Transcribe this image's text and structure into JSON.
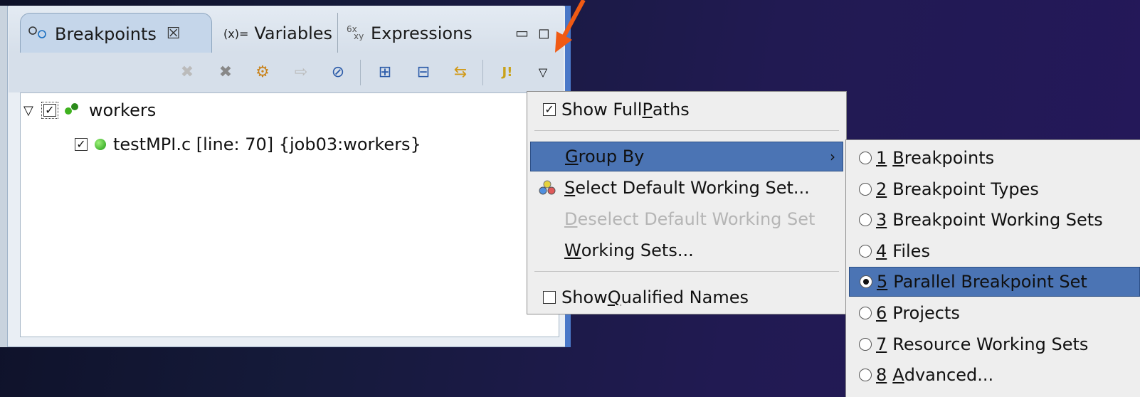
{
  "view": {
    "tabs": [
      {
        "label": "Breakpoints",
        "icon": "breakpoints-icon",
        "close": "☒"
      },
      {
        "label": "Variables",
        "icon": "variables-icon",
        "prefix": "(x)="
      },
      {
        "label": "Expressions",
        "icon": "expressions-icon"
      }
    ],
    "tree": [
      {
        "label": "workers",
        "checked": true,
        "expanded": true
      },
      {
        "label": "testMPI.c [line: 70] {job03:workers}",
        "checked": true
      }
    ]
  },
  "view_menu": {
    "show_full_paths": {
      "pre": "Show Full ",
      "ul": "P",
      "post": "aths"
    },
    "group_by": {
      "ul": "G",
      "post": "roup By"
    },
    "select_default": {
      "ul": "S",
      "post": "elect Default Working Set..."
    },
    "deselect_default": {
      "ul": "D",
      "post": "eselect Default Working Set"
    },
    "working_sets": {
      "ul": "W",
      "post": "orking Sets..."
    },
    "show_qualified": {
      "pre": "Show ",
      "ul": "Q",
      "post": "ualified Names"
    }
  },
  "group_by_menu": [
    {
      "num": "1",
      "ul": "B",
      "text": "reakpoints",
      "selected": false
    },
    {
      "num": "2",
      "ul": "",
      "text": "Breakpoint Types",
      "selected": false
    },
    {
      "num": "3",
      "ul": "",
      "text": "Breakpoint Working Sets",
      "selected": false
    },
    {
      "num": "4",
      "ul": "",
      "text": "Files",
      "selected": false
    },
    {
      "num": "5",
      "ul": "",
      "text": "Parallel Breakpoint Set",
      "selected": true
    },
    {
      "num": "6",
      "ul": "",
      "text": "Projects",
      "selected": false
    },
    {
      "num": "7",
      "ul": "",
      "text": "Resource Working Sets",
      "selected": false
    },
    {
      "num": "8",
      "ul": "A",
      "text": "dvanced...",
      "selected": false
    }
  ],
  "colors": {
    "accent": "#4b74b4",
    "arrow": "#f05a14"
  }
}
